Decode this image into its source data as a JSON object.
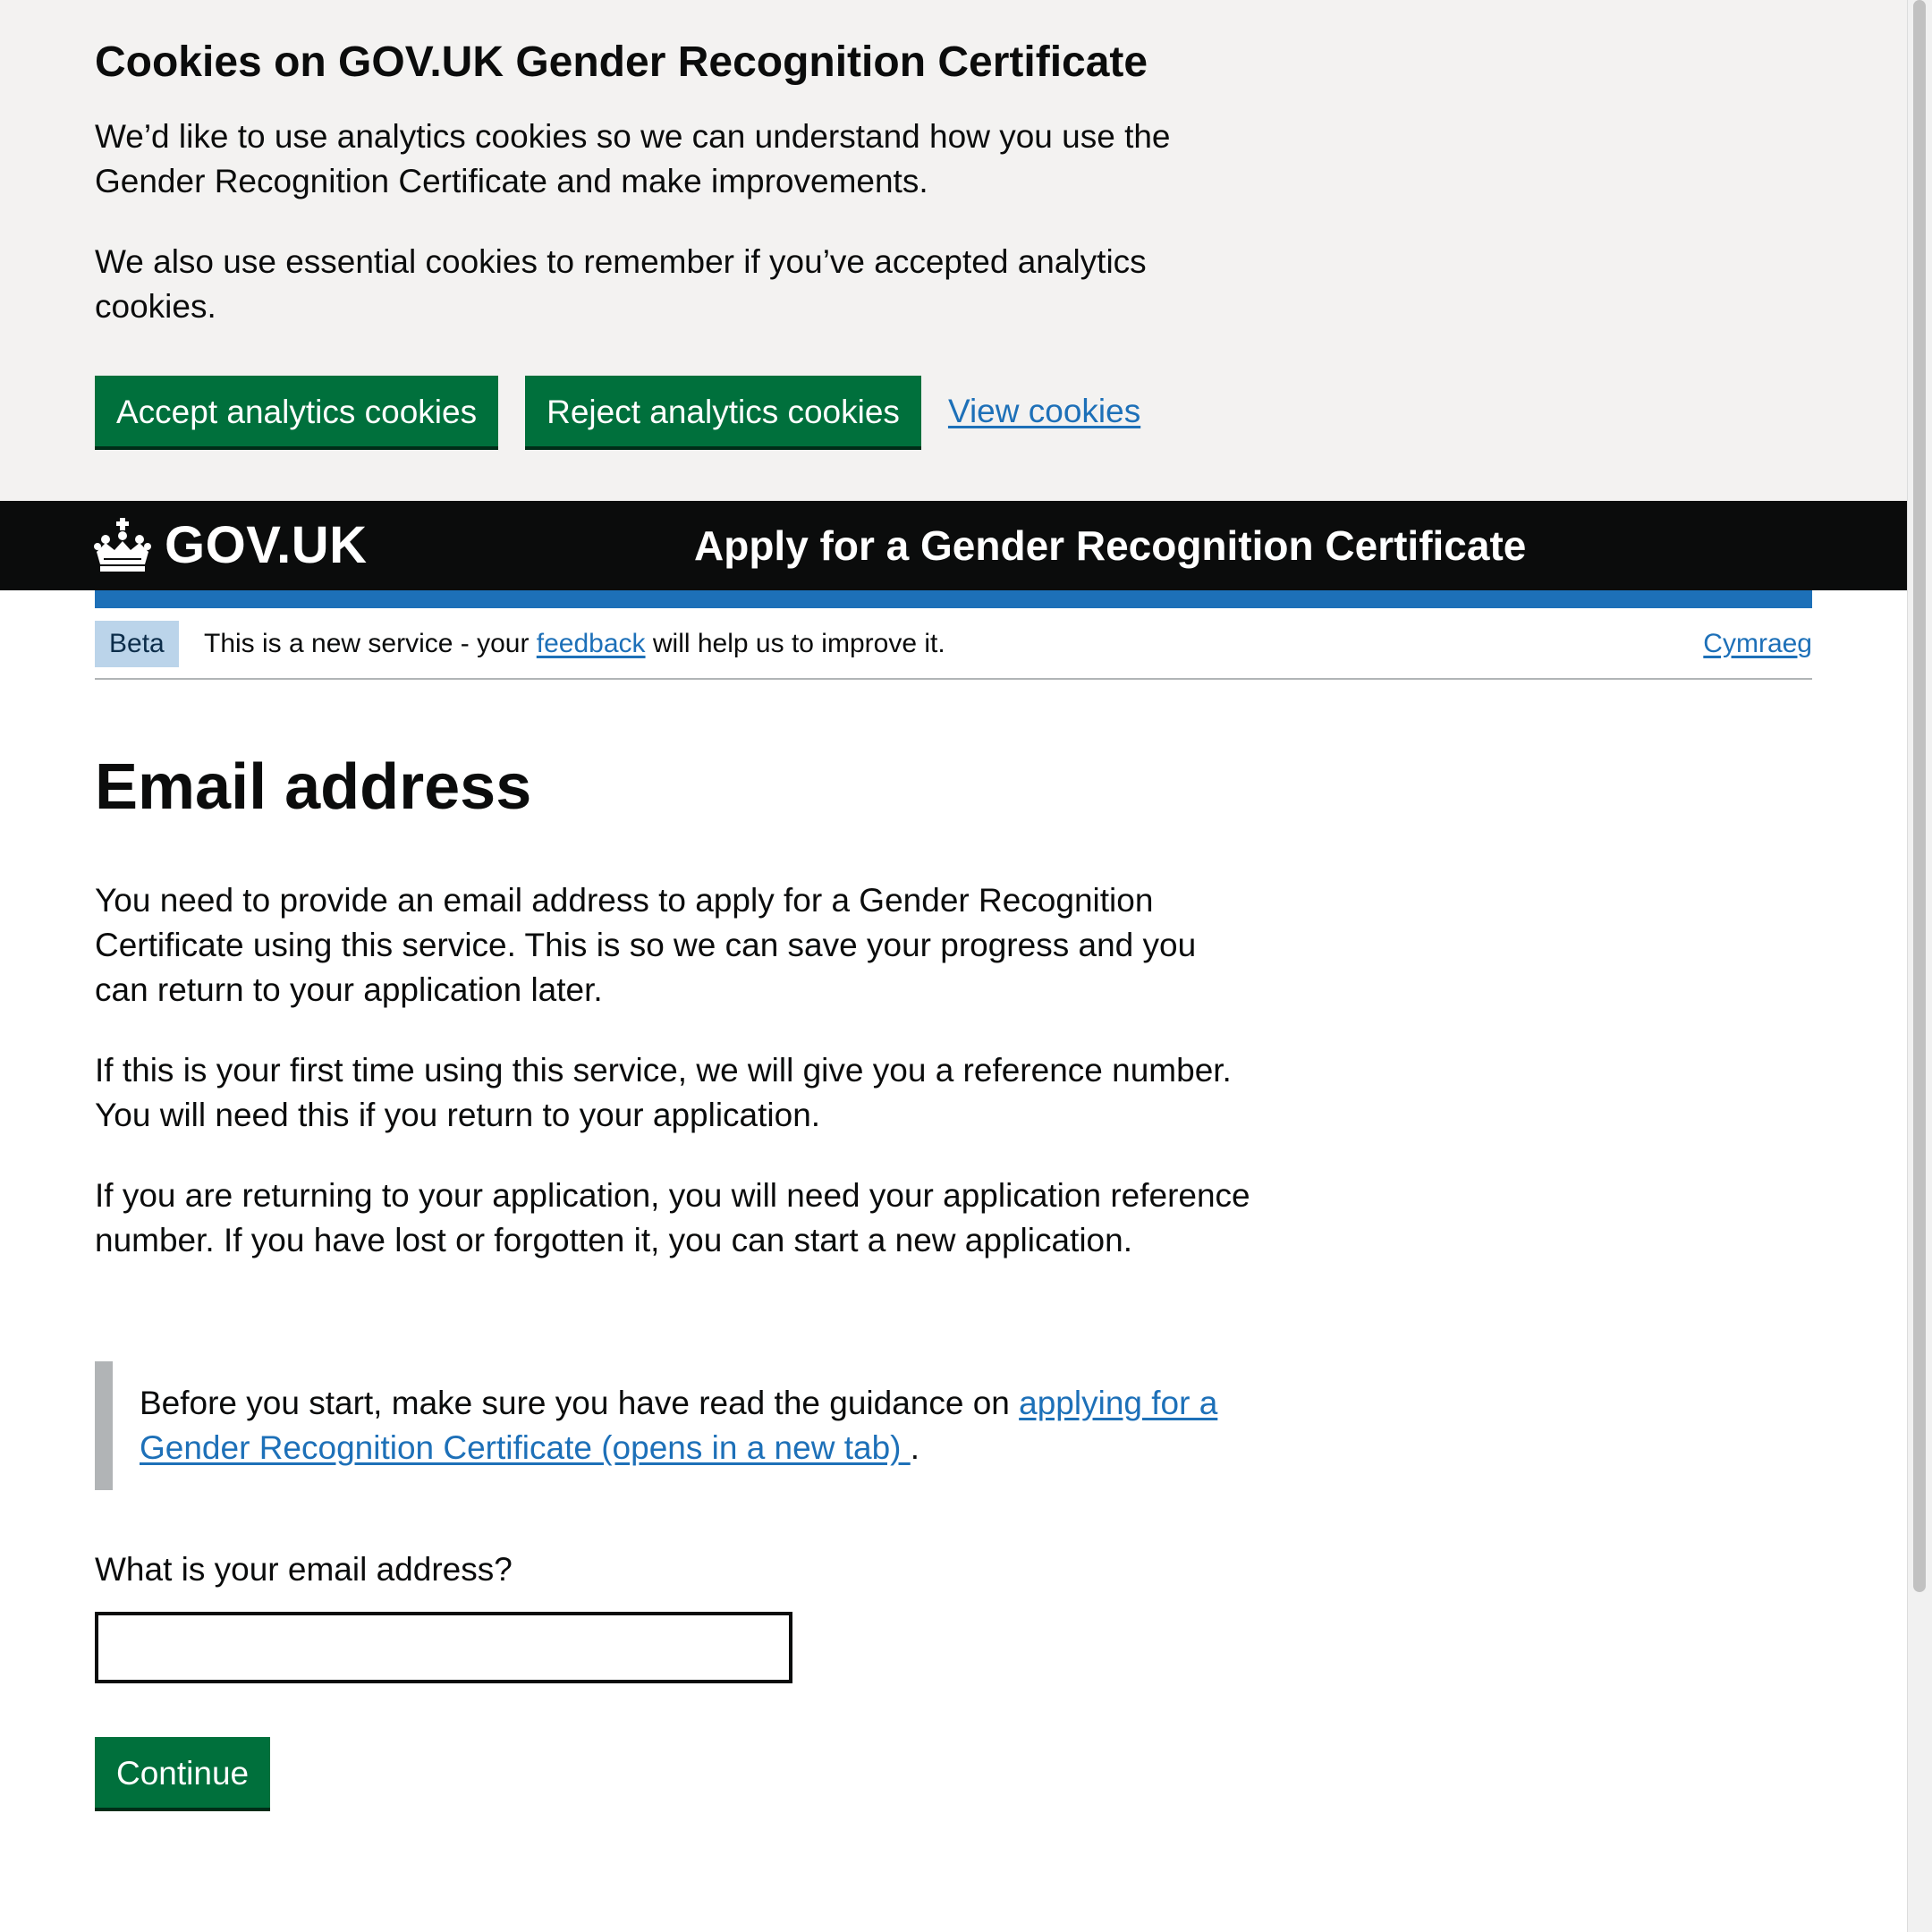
{
  "cookie_banner": {
    "title": "Cookies on GOV.UK Gender Recognition Certificate",
    "para1": "We’d like to use analytics cookies so we can understand how you use the Gender Recognition Certificate and make improvements.",
    "para2": "We also use essential cookies to remember if you’ve accepted analytics cookies.",
    "accept_label": "Accept analytics cookies",
    "reject_label": "Reject analytics cookies",
    "view_label": "View cookies"
  },
  "header": {
    "logo_text": "GOV.UK",
    "service_name": "Apply for a Gender Recognition Certificate",
    "logo_icon": "crown-icon"
  },
  "phase_banner": {
    "tag": "Beta",
    "text_before": "This is a new service - your ",
    "link": "feedback",
    "text_after": " will help us to improve it.",
    "language_link": "Cymraeg"
  },
  "main": {
    "title": "Email address",
    "para1": "You need to provide an email address to apply for a Gender Recognition Certificate using this service. This is so we can save your progress and you can return to your application later.",
    "para2": "If this is your first time using this service, we will give you a reference number. You will need this if you return to your application.",
    "para3": "If you are returning to your application, you will need your application reference number. If you have lost or forgotten it, you can start a new application.",
    "inset_before": "Before you start, make sure you have read the guidance on ",
    "inset_link": "applying for a Gender Recognition Certificate (opens in a new tab) ",
    "inset_after": ".",
    "email_label": "What is your email address?",
    "email_value": "",
    "continue_label": "Continue"
  },
  "colors": {
    "button_green": "#00703c",
    "link_blue": "#1d70b8",
    "header_black": "#0b0c0c",
    "banner_grey": "#f3f2f1"
  }
}
